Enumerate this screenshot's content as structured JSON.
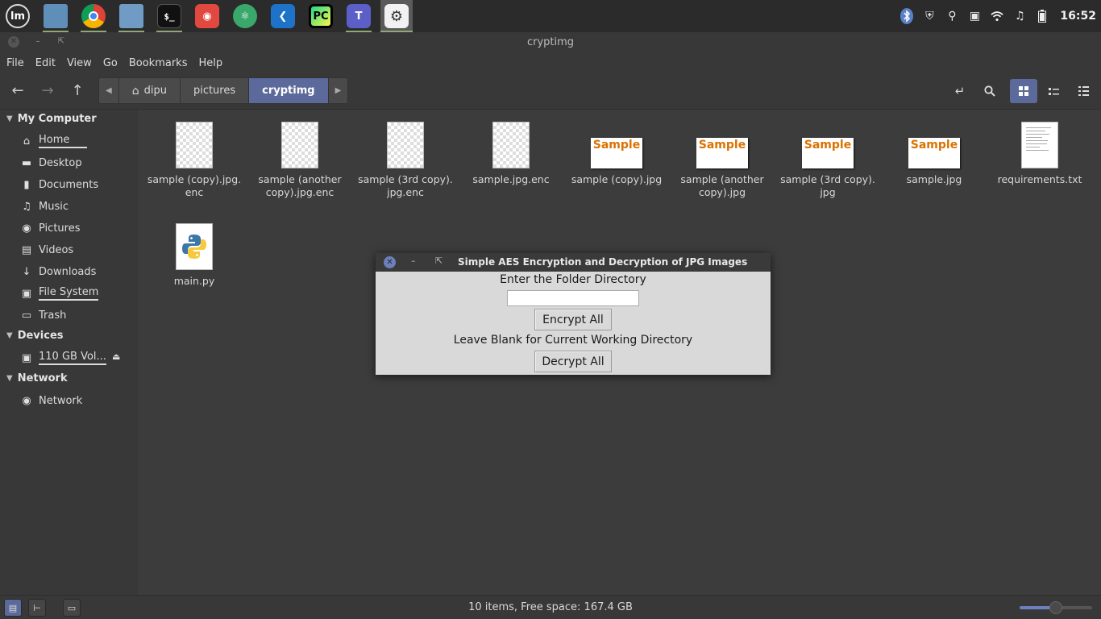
{
  "taskbar": {
    "apps": [
      {
        "name": "mint-menu-icon"
      },
      {
        "name": "files-icon"
      },
      {
        "name": "chrome-icon"
      },
      {
        "name": "folder-icon"
      },
      {
        "name": "terminal-icon",
        "glyph": "$_"
      },
      {
        "name": "gitkraken-icon"
      },
      {
        "name": "atom-icon"
      },
      {
        "name": "vscode-icon"
      },
      {
        "name": "pycharm-icon",
        "glyph": "PC"
      },
      {
        "name": "teams-icon",
        "glyph": "T"
      },
      {
        "name": "settings-icon"
      }
    ],
    "tray": [
      "bluetooth-icon",
      "shield-icon",
      "lightbulb-icon",
      "drive-icon",
      "wifi-icon",
      "music-icon",
      "battery-icon"
    ],
    "clock": "16:52"
  },
  "window": {
    "title": "cryptimg"
  },
  "menu": [
    "File",
    "Edit",
    "View",
    "Go",
    "Bookmarks",
    "Help"
  ],
  "path": {
    "segments": [
      "dipu",
      "pictures",
      "cryptimg"
    ]
  },
  "sidebar": {
    "sections": [
      {
        "title": "My Computer",
        "items": [
          {
            "label": "Home",
            "icon": "home-icon"
          },
          {
            "label": "Desktop",
            "icon": "desktop-icon"
          },
          {
            "label": "Documents",
            "icon": "documents-icon"
          },
          {
            "label": "Music",
            "icon": "music-icon"
          },
          {
            "label": "Pictures",
            "icon": "pictures-icon"
          },
          {
            "label": "Videos",
            "icon": "videos-icon"
          },
          {
            "label": "Downloads",
            "icon": "downloads-icon"
          },
          {
            "label": "File System",
            "icon": "filesystem-icon"
          },
          {
            "label": "Trash",
            "icon": "trash-icon"
          }
        ]
      },
      {
        "title": "Devices",
        "items": [
          {
            "label": "110 GB Vol...",
            "icon": "drive-icon"
          }
        ]
      },
      {
        "title": "Network",
        "items": [
          {
            "label": "Network",
            "icon": "network-icon"
          }
        ]
      }
    ]
  },
  "files": [
    {
      "name1": "sample (copy).jpg.",
      "name2": "enc",
      "type": "enc"
    },
    {
      "name1": "sample (another",
      "name2": "copy).jpg.enc",
      "type": "enc"
    },
    {
      "name1": "sample (3rd copy).",
      "name2": "jpg.enc",
      "type": "enc"
    },
    {
      "name1": "sample.jpg.enc",
      "name2": "",
      "type": "enc"
    },
    {
      "name1": "sample (copy).jpg",
      "name2": "",
      "type": "jpg",
      "thumb_text": "Sample"
    },
    {
      "name1": "sample (another",
      "name2": "copy).jpg",
      "type": "jpg",
      "thumb_text": "Sample"
    },
    {
      "name1": "sample (3rd copy).",
      "name2": "jpg",
      "type": "jpg",
      "thumb_text": "Sample"
    },
    {
      "name1": "sample.jpg",
      "name2": "",
      "type": "jpg",
      "thumb_text": "Sample"
    },
    {
      "name1": "requirements.txt",
      "name2": "",
      "type": "txt"
    },
    {
      "name1": "main.py",
      "name2": "",
      "type": "py"
    }
  ],
  "dialog": {
    "title": "Simple AES Encryption and Decryption of JPG Images",
    "label_dir": "Enter the Folder Directory",
    "input_value": "",
    "encrypt_label": "Encrypt All",
    "hint": "Leave Blank for Current Working Directory",
    "decrypt_label": "Decrypt All"
  },
  "status": {
    "text": "10 items, Free space: 167.4 GB",
    "zoom_fraction": 0.5
  },
  "colors": {
    "accent": "#5b6a9a",
    "thumb_text": "#d97200"
  }
}
